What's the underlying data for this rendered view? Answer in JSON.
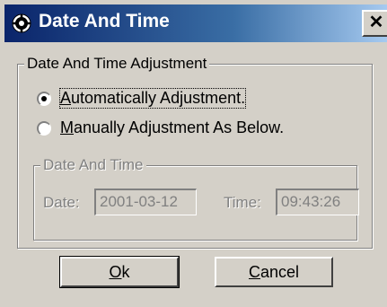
{
  "window": {
    "title": "Date And Time",
    "close_glyph": "✕",
    "title_icon": "clock-gear-icon"
  },
  "adjustment_group": {
    "legend": "Date And Time Adjustment",
    "options": [
      {
        "underline_char": "A",
        "rest": "utomatically Adjustment.",
        "checked": true
      },
      {
        "underline_char": "M",
        "rest": "anually Adjustment As Below.",
        "checked": false
      }
    ]
  },
  "datetime_group": {
    "legend": "Date And Time",
    "date_label": "Date:",
    "date_value": "2001-03-12",
    "time_label": "Time:",
    "time_value": "09:43:26"
  },
  "buttons": {
    "ok_underline": "O",
    "ok_rest": "k",
    "cancel_underline": "C",
    "cancel_rest": "ancel"
  },
  "colors": {
    "face": "#d4d0c8",
    "title_start": "#0a246a",
    "title_end": "#a6caf0",
    "disabled_text": "#808080"
  }
}
